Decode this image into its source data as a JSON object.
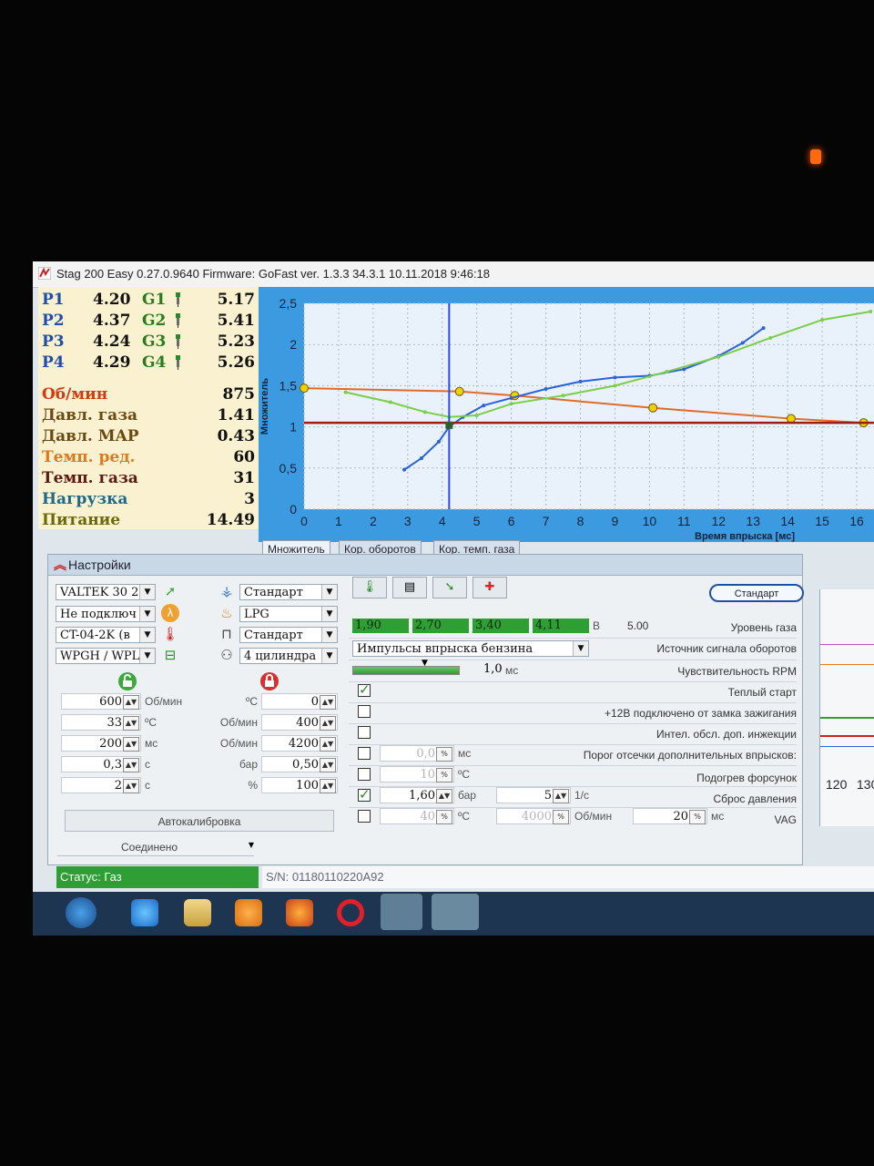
{
  "window": {
    "title": "Stag 200 Easy 0.27.0.9640 Firmware: GoFast  ver. 1.3.3  34.3.1   10.11.2018 9:46:18"
  },
  "live": {
    "injectors": [
      {
        "p": "P1",
        "pv": "4.20",
        "g": "G1",
        "gv": "5.17"
      },
      {
        "p": "P2",
        "pv": "4.37",
        "g": "G2",
        "gv": "5.41"
      },
      {
        "p": "P3",
        "pv": "4.24",
        "g": "G3",
        "gv": "5.23"
      },
      {
        "p": "P4",
        "pv": "4.29",
        "g": "G4",
        "gv": "5.26"
      }
    ],
    "metrics": [
      {
        "label": "Об/мин",
        "value": "875",
        "color": "#d23a10"
      },
      {
        "label": "Давл. газа",
        "value": "1.41",
        "color": "#6b4a12"
      },
      {
        "label": "Давл. MAP",
        "value": "0.43",
        "color": "#6b4a12"
      },
      {
        "label": "Темп. ред.",
        "value": "60",
        "color": "#e0791b"
      },
      {
        "label": "Темп. газа",
        "value": "31",
        "color": "#5a1a10"
      },
      {
        "label": "Нагрузка",
        "value": "3",
        "color": "#1b6a8c"
      },
      {
        "label": "Питание",
        "value": "14.49",
        "color": "#6a6a08"
      }
    ]
  },
  "chart_data": {
    "type": "line",
    "title": "",
    "xlabel": "Время впрыска [мс]",
    "ylabel": "Множитель",
    "xlim": [
      0,
      16.5
    ],
    "ylim": [
      0,
      2.5
    ],
    "xticks": [
      "0",
      "1",
      "2",
      "3",
      "4",
      "5",
      "6",
      "7",
      "8",
      "9",
      "10",
      "11",
      "12",
      "13",
      "14",
      "15",
      "16"
    ],
    "yticks": [
      "0",
      "0,5",
      "1",
      "1,5",
      "2",
      "2,5"
    ],
    "grid": true,
    "cursor_x": 4.2,
    "series": [
      {
        "color": "#e06a2a",
        "marker": "#f2d000",
        "x": [
          0,
          4.5,
          6.1,
          10.1,
          14.1,
          16.2
        ],
        "y": [
          1.47,
          1.43,
          1.38,
          1.23,
          1.1,
          1.05
        ]
      },
      {
        "color": "#2a62d8",
        "x": [
          2.9,
          3.4,
          3.9,
          4.2,
          4.6,
          5.2,
          6.0,
          7.0,
          8.0,
          9.0,
          10.0,
          11.0,
          12.0,
          12.7,
          13.3
        ],
        "y": [
          0.48,
          0.62,
          0.82,
          1.0,
          1.12,
          1.26,
          1.35,
          1.46,
          1.55,
          1.6,
          1.62,
          1.7,
          1.86,
          2.02,
          2.2
        ]
      },
      {
        "color": "#7ccd4a",
        "x": [
          1.2,
          2.5,
          3.5,
          4.2,
          5.0,
          6.0,
          7.5,
          9.0,
          10.5,
          12.0,
          13.5,
          15.0,
          16.4
        ],
        "y": [
          1.42,
          1.3,
          1.18,
          1.12,
          1.14,
          1.28,
          1.38,
          1.5,
          1.67,
          1.85,
          2.08,
          2.3,
          2.4
        ]
      },
      {
        "color": "#9c1e12",
        "x": [
          0,
          16.5
        ],
        "y": [
          1.05,
          1.05
        ]
      }
    ],
    "marker_points": [
      {
        "x": 4.2,
        "y": 1.02,
        "color": "#2e5e2e"
      }
    ]
  },
  "tabs": [
    "Множитель",
    "Кор. оборотов",
    "Кор. темп. газа"
  ],
  "settings": {
    "title": "Настройки",
    "left_combos": [
      "VALTEK 30 2",
      "Не подключ",
      "CT-04-2K (в",
      "WPGH / WPL"
    ],
    "mid_combos": [
      "Стандарт",
      "LPG",
      "Стандарт",
      "4 цилиндра"
    ],
    "left_rows": [
      {
        "v1": "600",
        "u1": "Об/мин",
        "u2": "ºC",
        "v2": "0"
      },
      {
        "v1": "33",
        "u1": "ºC",
        "u2": "Об/мин",
        "v2": "400"
      },
      {
        "v1": "200",
        "u1": "мс",
        "u2": "Об/мин",
        "v2": "4200"
      },
      {
        "v1": "0,3",
        "u1": "с",
        "u2": "бар",
        "v2": "0,50"
      },
      {
        "v1": "2",
        "u1": "с",
        "u2": "%",
        "v2": "100"
      }
    ],
    "autocal": "Автокалибровка",
    "connected": "Соединено",
    "std_button": "Стандарт",
    "gas_levels": [
      "1,90",
      "2,70",
      "3,40",
      "4,11"
    ],
    "gas_unit": "В",
    "gas_max": "5.00",
    "rpm_source": "Импульсы впрыска бензина",
    "rpm_sens": "1,0",
    "rpm_sens_unit": "мс",
    "labels": {
      "gas_level": "Уровень газа",
      "rpm_source": "Источник сигнала оборотов",
      "rpm_sens": "Чувствительность RPM",
      "warm_start": "Теплый старт",
      "ign": "+12В подключено от замка зажигания",
      "intel": "Интел. обсл. доп. инжекции",
      "cutoff": "Порог отсечки дополнительных впрысков:",
      "heat": "Подогрев форсунок",
      "reset": "Сброс давления",
      "vag": "VAG"
    },
    "checks": [
      true,
      false,
      false,
      false,
      false,
      true,
      false
    ],
    "cutoff": {
      "v": "0,0",
      "u": "мс"
    },
    "heat": {
      "v": "10",
      "u": "ºC"
    },
    "reset": {
      "v": "1,60",
      "u": "бар",
      "v2": "5",
      "u2": "1/с"
    },
    "vag": {
      "v": "40",
      "u": "ºC",
      "v2": "4000",
      "u2": "Об/мин",
      "v3": "20",
      "u3": "мс"
    }
  },
  "status": {
    "text": "Статус: Газ",
    "sn": "S/N: 01180110220A92"
  },
  "right_axis": [
    "120",
    "130"
  ],
  "colors": {
    "status_green": "#2f9e35",
    "accent_blue": "#2a62d8",
    "chart_bg": "#e9f2fb",
    "axis_panel": "#3c9be0"
  }
}
